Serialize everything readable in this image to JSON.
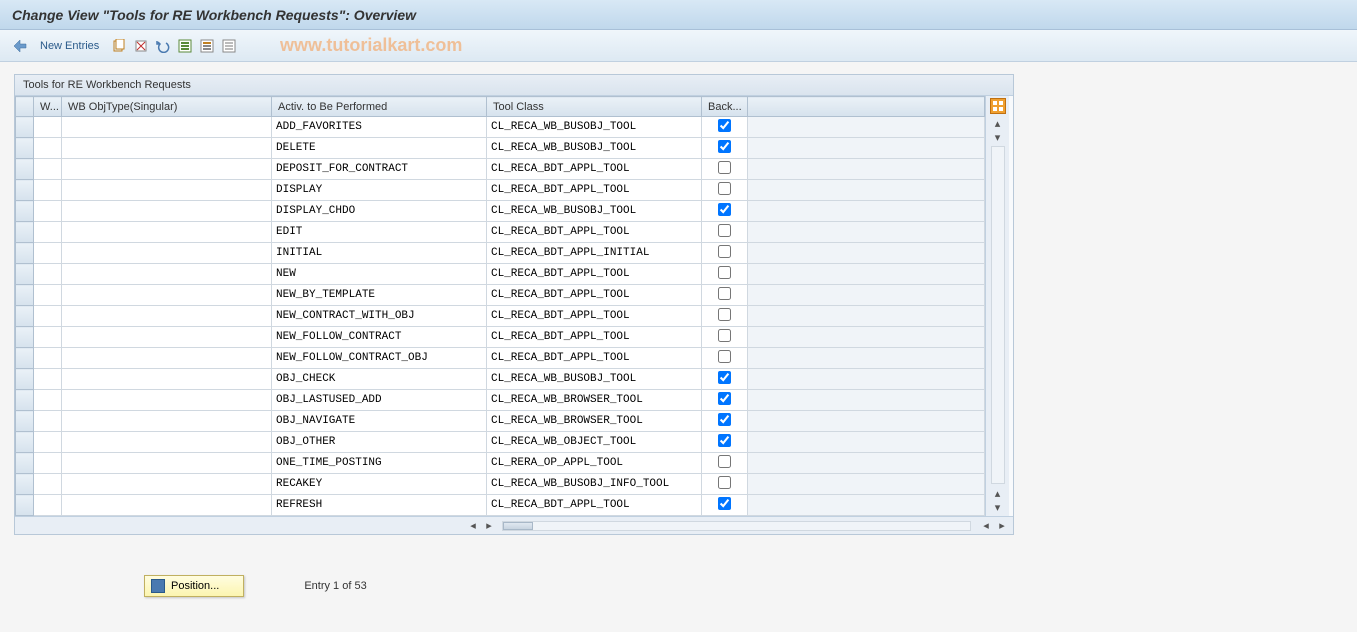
{
  "title": "Change View \"Tools for RE Workbench Requests\": Overview",
  "toolbar": {
    "new_entries_label": "New Entries"
  },
  "watermark": "www.tutorialkart.com",
  "panel": {
    "title": "Tools for RE Workbench Requests"
  },
  "columns": {
    "w": "W...",
    "objtype": "WB ObjType(Singular)",
    "activ": "Activ. to Be Performed",
    "toolclass": "Tool Class",
    "back": "Back..."
  },
  "rows": [
    {
      "w": "",
      "objtype": "",
      "activ": "ADD_FAVORITES",
      "toolclass": "CL_RECA_WB_BUSOBJ_TOOL",
      "back": true
    },
    {
      "w": "",
      "objtype": "",
      "activ": "DELETE",
      "toolclass": "CL_RECA_WB_BUSOBJ_TOOL",
      "back": true
    },
    {
      "w": "",
      "objtype": "",
      "activ": "DEPOSIT_FOR_CONTRACT",
      "toolclass": "CL_RECA_BDT_APPL_TOOL",
      "back": false
    },
    {
      "w": "",
      "objtype": "",
      "activ": "DISPLAY",
      "toolclass": "CL_RECA_BDT_APPL_TOOL",
      "back": false
    },
    {
      "w": "",
      "objtype": "",
      "activ": "DISPLAY_CHDO",
      "toolclass": "CL_RECA_WB_BUSOBJ_TOOL",
      "back": true
    },
    {
      "w": "",
      "objtype": "",
      "activ": "EDIT",
      "toolclass": "CL_RECA_BDT_APPL_TOOL",
      "back": false
    },
    {
      "w": "",
      "objtype": "",
      "activ": "INITIAL",
      "toolclass": "CL_RECA_BDT_APPL_INITIAL",
      "back": false
    },
    {
      "w": "",
      "objtype": "",
      "activ": "NEW",
      "toolclass": "CL_RECA_BDT_APPL_TOOL",
      "back": false
    },
    {
      "w": "",
      "objtype": "",
      "activ": "NEW_BY_TEMPLATE",
      "toolclass": "CL_RECA_BDT_APPL_TOOL",
      "back": false
    },
    {
      "w": "",
      "objtype": "",
      "activ": "NEW_CONTRACT_WITH_OBJ",
      "toolclass": "CL_RECA_BDT_APPL_TOOL",
      "back": false
    },
    {
      "w": "",
      "objtype": "",
      "activ": "NEW_FOLLOW_CONTRACT",
      "toolclass": "CL_RECA_BDT_APPL_TOOL",
      "back": false
    },
    {
      "w": "",
      "objtype": "",
      "activ": "NEW_FOLLOW_CONTRACT_OBJ",
      "toolclass": "CL_RECA_BDT_APPL_TOOL",
      "back": false
    },
    {
      "w": "",
      "objtype": "",
      "activ": "OBJ_CHECK",
      "toolclass": "CL_RECA_WB_BUSOBJ_TOOL",
      "back": true
    },
    {
      "w": "",
      "objtype": "",
      "activ": "OBJ_LASTUSED_ADD",
      "toolclass": "CL_RECA_WB_BROWSER_TOOL",
      "back": true
    },
    {
      "w": "",
      "objtype": "",
      "activ": "OBJ_NAVIGATE",
      "toolclass": "CL_RECA_WB_BROWSER_TOOL",
      "back": true
    },
    {
      "w": "",
      "objtype": "",
      "activ": "OBJ_OTHER",
      "toolclass": "CL_RECA_WB_OBJECT_TOOL",
      "back": true
    },
    {
      "w": "",
      "objtype": "",
      "activ": "ONE_TIME_POSTING",
      "toolclass": "CL_RERA_OP_APPL_TOOL",
      "back": false
    },
    {
      "w": "",
      "objtype": "",
      "activ": "RECAKEY",
      "toolclass": "CL_RECA_WB_BUSOBJ_INFO_TOOL",
      "back": false
    },
    {
      "w": "",
      "objtype": "",
      "activ": "REFRESH",
      "toolclass": "CL_RECA_BDT_APPL_TOOL",
      "back": true
    }
  ],
  "footer": {
    "position_label": "Position...",
    "entry_info": "Entry 1 of 53"
  }
}
